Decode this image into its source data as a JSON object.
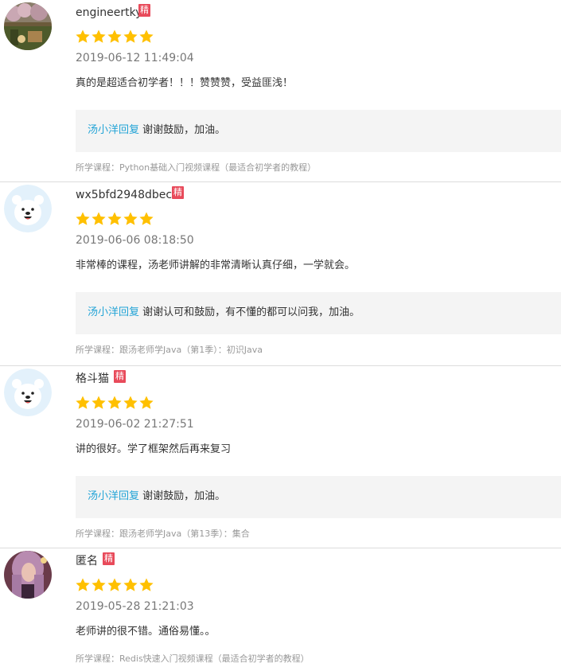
{
  "stars_color": "#ffc000",
  "badge_color": "#e84a5a",
  "reply_author_color": "#21a3d6",
  "reviews": [
    {
      "avatar": "photo-avatar",
      "username": "engineertky",
      "badge": "精",
      "rating": 5,
      "date": "2019-06-12 11:49:04",
      "content": "真的是超适合初学者！！！赞赞赞，受益匪浅！",
      "reply_author": "汤小洋回复",
      "reply_text": "谢谢鼓励，加油。",
      "course": "所学课程：Python基础入门视频课程（最适合初学者的教程）"
    },
    {
      "avatar": "bear-avatar",
      "username": "wx5bfd2948dbece",
      "badge": "精",
      "rating": 5,
      "date": "2019-06-06 08:18:50",
      "content": "非常棒的课程，汤老师讲解的非常清晰认真仔细，一学就会。",
      "reply_author": "汤小洋回复",
      "reply_text": "谢谢认可和鼓励，有不懂的都可以问我，加油。",
      "course": "所学课程：跟汤老师学Java（第1季）：初识Java"
    },
    {
      "avatar": "bear-avatar",
      "username": "格斗猫",
      "badge": "精",
      "rating": 5,
      "date": "2019-06-02 21:27:51",
      "content": "讲的很好。学了框架然后再来复习",
      "reply_author": "汤小洋回复",
      "reply_text": "谢谢鼓励，加油。",
      "course": "所学课程：跟汤老师学Java（第13季）：集合"
    },
    {
      "avatar": "photo-avatar",
      "username": "匿名",
      "badge": "精",
      "rating": 5,
      "date": "2019-05-28 21:21:03",
      "content": "老师讲的很不错。通俗易懂。。",
      "course": "所学课程：Redis快速入门视频课程（最适合初学者的教程）"
    }
  ]
}
